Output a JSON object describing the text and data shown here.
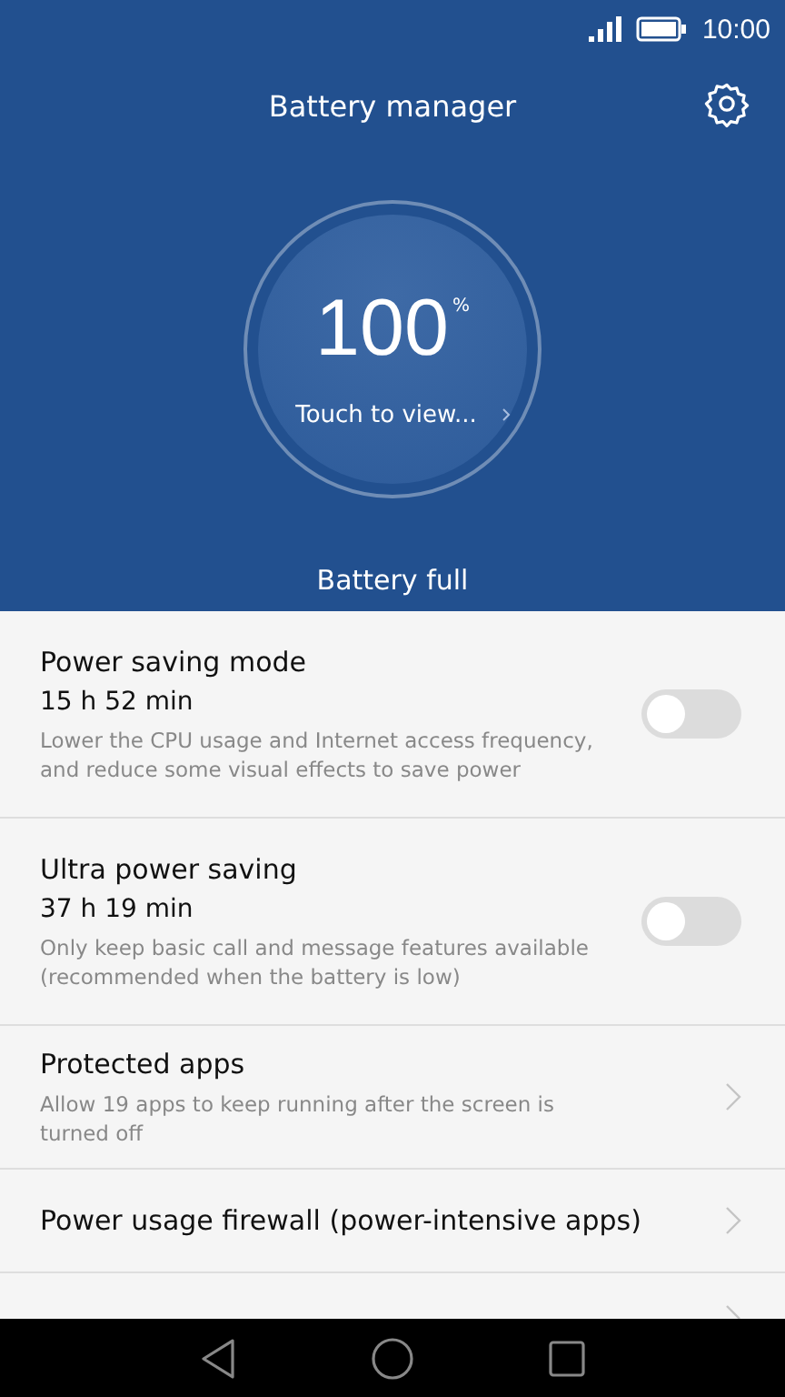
{
  "status_bar": {
    "time": "10:00"
  },
  "header": {
    "title": "Battery manager",
    "percent": "100",
    "percent_sign": "%",
    "link": "Touch to view...",
    "status": "Battery full"
  },
  "items": [
    {
      "kind": "toggle",
      "title": "Power saving mode",
      "value": "15 h 52 min",
      "description": "Lower the CPU usage and Internet access frequency, and reduce some visual effects to save power",
      "on": false
    },
    {
      "kind": "toggle",
      "title": "Ultra power saving",
      "value": "37 h 19 min",
      "description": "Only keep basic call and message features available (recommended when the battery is low)",
      "on": false
    },
    {
      "kind": "link",
      "title": "Protected apps",
      "description": "Allow 19 apps to keep running after the screen is turned off"
    },
    {
      "kind": "link",
      "title": "Power usage firewall (power-intensive apps)"
    }
  ]
}
